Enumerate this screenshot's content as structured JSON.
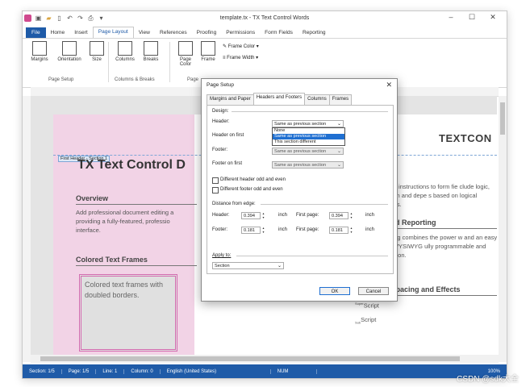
{
  "window": {
    "title": "template.tx - TX Text Control Words",
    "qat_icons": [
      "app-icon",
      "save-icon",
      "open-icon",
      "new-icon",
      "undo-icon",
      "redo-icon",
      "print-icon",
      "more-icon"
    ],
    "controls": {
      "minimize": "–",
      "maximize": "☐",
      "close": "✕"
    }
  },
  "ribbon": {
    "tabs": [
      {
        "label": "File"
      },
      {
        "label": "Home"
      },
      {
        "label": "Insert"
      },
      {
        "label": "Page Layout"
      },
      {
        "label": "View"
      },
      {
        "label": "References"
      },
      {
        "label": "Proofing"
      },
      {
        "label": "Permissions"
      },
      {
        "label": "Form Fields"
      },
      {
        "label": "Reporting"
      }
    ],
    "active_tab": "Page Layout",
    "buttons": {
      "margins": "Margins",
      "orientation": "Orientation",
      "size": "Size",
      "columns": "Columns",
      "breaks": "Breaks",
      "page_color": "Page Color",
      "frame": "Frame",
      "frame_color": "Frame Color",
      "frame_width": "Frame Width"
    },
    "groups": {
      "page_setup": "Page Setup",
      "columns_breaks": "Columns & Breaks",
      "page": "Page"
    }
  },
  "document": {
    "header_tag": "First Header - Section 1",
    "title": "TX Text Control D",
    "brand": "TEXTCON",
    "overview_heading": "Overview",
    "overview_text": "Add professional document editing a providing a fully-featured, professio interface.",
    "colored_frames_heading": "Colored Text Frames",
    "frame_text": "Colored text frames with doubled borders.",
    "right_text_1": "nditional instructions to form fie clude logic, validation and depe s based on logical operators.",
    "right_heading_1": "lds and Reporting",
    "right_text_2": "Reporting combines the power w and an easy-to-use WYSIWYG ully programmable and embedd on.",
    "right_heading_2": "Character Spacing and Effects",
    "superscript": "Script",
    "superscript_prefix": "Super",
    "subscript": "Script",
    "subscript_prefix": "Sub"
  },
  "status": {
    "section": "Section: 1/5",
    "page": "Page: 1/5",
    "line": "Line: 1",
    "column": "Column: 0",
    "language": "English (United States)",
    "num": "NUM",
    "zoom": "100%"
  },
  "dialog": {
    "title": "Page Setup",
    "tabs": [
      "Margins and Paper",
      "Headers and Footers",
      "Columns",
      "Frames"
    ],
    "active_tab": "Headers and Footers",
    "design_label": "Design:",
    "header_label": "Header:",
    "header_first_label": "Header on first",
    "footer_label": "Footer:",
    "footer_first_label": "Footer on first",
    "header_value": "Same as previous section",
    "dropdown_options": [
      "None",
      "Same as previous section",
      "This section different"
    ],
    "dropdown_selected": "Same as previous section",
    "header_first_value": "Same as previous section",
    "footer_value": "Same as previous section",
    "footer_first_value": "Same as previous section",
    "odd_even_header": "Different header odd and even",
    "odd_even_footer": "Different footer odd and even",
    "distance_label": "Distance from edge:",
    "header_dist_label": "Header:",
    "header_dist": "0.394",
    "footer_dist_label": "Footer:",
    "footer_dist": "0.181",
    "unit": "inch",
    "first_page_label": "First page:",
    "header_first_dist": "0.394",
    "footer_first_dist": "0.181",
    "apply_label": "Apply to:",
    "apply_value": "Section",
    "ok": "OK",
    "cancel": "Cancel"
  },
  "watermark": "CSDN @sdk大全",
  "colors": {
    "accent": "#1f5ba8",
    "highlight": "#1f6fd1",
    "pink": "#f2d3e6",
    "frame_border": "#d46bb0"
  }
}
